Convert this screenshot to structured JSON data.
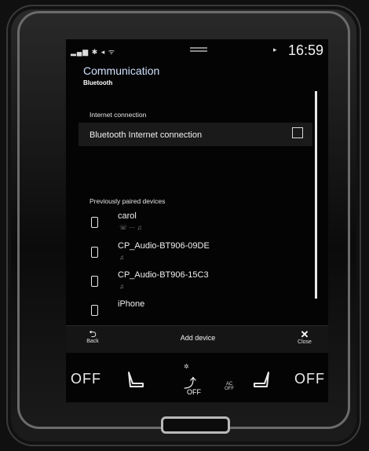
{
  "status_bar": {
    "signal_text": "▂▄▆ ✱ ◂ ᯤ",
    "nav_arrow": "▸",
    "time": "16:59"
  },
  "header": {
    "title": "Communication",
    "subtitle": "Bluetooth"
  },
  "internet_section": {
    "label": "Internet connection",
    "bt_internet_label": "Bluetooth Internet connection",
    "bt_internet_checked": false
  },
  "paired_section": {
    "label": "Previously paired devices",
    "devices": [
      {
        "name": "carol",
        "sub": "☏ ··· ♫"
      },
      {
        "name": "CP_Audio-BT906-09DE",
        "sub": "♫"
      },
      {
        "name": "CP_Audio-BT906-15C3",
        "sub": "♫"
      },
      {
        "name": "iPhone",
        "sub": ""
      }
    ]
  },
  "bottom_bar": {
    "back_label": "Back",
    "add_device_label": "Add device",
    "close_label": "Close"
  },
  "climate": {
    "left_temp": "OFF",
    "right_temp": "OFF",
    "fan_label": "OFF",
    "ac_top": "AC",
    "ac_bottom": "OFF"
  }
}
